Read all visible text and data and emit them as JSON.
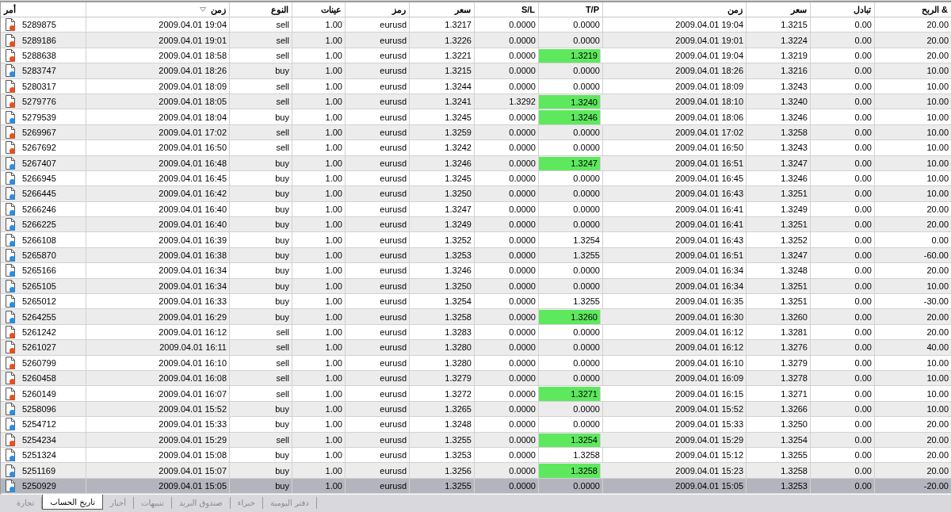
{
  "table": {
    "columns": [
      {
        "label": "أمر",
        "sorted": false
      },
      {
        "label": "زمن",
        "sorted": true
      },
      {
        "label": "النوع",
        "sorted": false
      },
      {
        "label": "عينات",
        "sorted": false
      },
      {
        "label": "رمز",
        "sorted": false
      },
      {
        "label": "سعر",
        "sorted": false
      },
      {
        "label": "S/L",
        "sorted": false
      },
      {
        "label": "T/P",
        "sorted": false
      },
      {
        "label": "زمن",
        "sorted": false
      },
      {
        "label": "سعر",
        "sorted": false
      },
      {
        "label": "تبادل",
        "sorted": false
      },
      {
        "label": "الربح &",
        "sorted": false
      }
    ],
    "rows": [
      {
        "color": "#e8501e",
        "tp_hit": false,
        "selected": false,
        "cells": [
          "5289875",
          "2009.04.01 19:04",
          "sell",
          "1.00",
          "eurusd",
          "1.3217",
          "0.0000",
          "0.0000",
          "2009.04.01 19:04",
          "1.3215",
          "0.00",
          "20.00"
        ]
      },
      {
        "color": "#e8501e",
        "tp_hit": false,
        "selected": false,
        "cells": [
          "5289186",
          "2009.04.01 19:01",
          "sell",
          "1.00",
          "eurusd",
          "1.3226",
          "0.0000",
          "0.0000",
          "2009.04.01 19:01",
          "1.3224",
          "0.00",
          "20.00"
        ]
      },
      {
        "color": "#e8501e",
        "tp_hit": true,
        "selected": false,
        "cells": [
          "5288638",
          "2009.04.01 18:58",
          "sell",
          "1.00",
          "eurusd",
          "1.3221",
          "0.0000",
          "1.3219",
          "2009.04.01 19:04",
          "1.3219",
          "0.00",
          "20.00"
        ]
      },
      {
        "color": "#2a8ee0",
        "tp_hit": false,
        "selected": false,
        "cells": [
          "5283747",
          "2009.04.01 18:26",
          "buy",
          "1.00",
          "eurusd",
          "1.3215",
          "0.0000",
          "0.0000",
          "2009.04.01 18:26",
          "1.3216",
          "0.00",
          "10.00"
        ]
      },
      {
        "color": "#e8501e",
        "tp_hit": false,
        "selected": false,
        "cells": [
          "5280317",
          "2009.04.01 18:09",
          "sell",
          "1.00",
          "eurusd",
          "1.3244",
          "0.0000",
          "0.0000",
          "2009.04.01 18:09",
          "1.3243",
          "0.00",
          "10.00"
        ]
      },
      {
        "color": "#e8501e",
        "tp_hit": true,
        "selected": false,
        "cells": [
          "5279776",
          "2009.04.01 18:05",
          "sell",
          "1.00",
          "eurusd",
          "1.3241",
          "1.3292",
          "1.3240",
          "2009.04.01 18:10",
          "1.3240",
          "0.00",
          "10.00"
        ]
      },
      {
        "color": "#2a8ee0",
        "tp_hit": true,
        "selected": false,
        "cells": [
          "5279539",
          "2009.04.01 18:04",
          "buy",
          "1.00",
          "eurusd",
          "1.3245",
          "0.0000",
          "1.3246",
          "2009.04.01 18:06",
          "1.3246",
          "0.00",
          "10.00"
        ]
      },
      {
        "color": "#e8501e",
        "tp_hit": false,
        "selected": false,
        "cells": [
          "5269967",
          "2009.04.01 17:02",
          "sell",
          "1.00",
          "eurusd",
          "1.3259",
          "0.0000",
          "0.0000",
          "2009.04.01 17:02",
          "1.3258",
          "0.00",
          "10.00"
        ]
      },
      {
        "color": "#e8501e",
        "tp_hit": false,
        "selected": false,
        "cells": [
          "5267692",
          "2009.04.01 16:50",
          "sell",
          "1.00",
          "eurusd",
          "1.3242",
          "0.0000",
          "0.0000",
          "2009.04.01 16:50",
          "1.3243",
          "0.00",
          "10.00"
        ]
      },
      {
        "color": "#2a8ee0",
        "tp_hit": true,
        "selected": false,
        "cells": [
          "5267407",
          "2009.04.01 16:48",
          "buy",
          "1.00",
          "eurusd",
          "1.3246",
          "0.0000",
          "1.3247",
          "2009.04.01 16:51",
          "1.3247",
          "0.00",
          "10.00"
        ]
      },
      {
        "color": "#2a8ee0",
        "tp_hit": false,
        "selected": false,
        "cells": [
          "5266945",
          "2009.04.01 16:45",
          "buy",
          "1.00",
          "eurusd",
          "1.3245",
          "0.0000",
          "0.0000",
          "2009.04.01 16:45",
          "1.3246",
          "0.00",
          "10.00"
        ]
      },
      {
        "color": "#2a8ee0",
        "tp_hit": false,
        "selected": false,
        "cells": [
          "5266445",
          "2009.04.01 16:42",
          "buy",
          "1.00",
          "eurusd",
          "1.3250",
          "0.0000",
          "0.0000",
          "2009.04.01 16:43",
          "1.3251",
          "0.00",
          "10.00"
        ]
      },
      {
        "color": "#2a8ee0",
        "tp_hit": false,
        "selected": false,
        "cells": [
          "5266246",
          "2009.04.01 16:40",
          "buy",
          "1.00",
          "eurusd",
          "1.3247",
          "0.0000",
          "0.0000",
          "2009.04.01 16:41",
          "1.3249",
          "0.00",
          "20.00"
        ]
      },
      {
        "color": "#2a8ee0",
        "tp_hit": false,
        "selected": false,
        "cells": [
          "5266225",
          "2009.04.01 16:40",
          "buy",
          "1.00",
          "eurusd",
          "1.3249",
          "0.0000",
          "0.0000",
          "2009.04.01 16:41",
          "1.3251",
          "0.00",
          "20.00"
        ]
      },
      {
        "color": "#2a8ee0",
        "tp_hit": false,
        "selected": false,
        "cells": [
          "5266108",
          "2009.04.01 16:39",
          "buy",
          "1.00",
          "eurusd",
          "1.3252",
          "0.0000",
          "1.3254",
          "2009.04.01 16:43",
          "1.3252",
          "0.00",
          "0.00"
        ]
      },
      {
        "color": "#2a8ee0",
        "tp_hit": false,
        "selected": false,
        "cells": [
          "5265870",
          "2009.04.01 16:38",
          "buy",
          "1.00",
          "eurusd",
          "1.3253",
          "0.0000",
          "1.3255",
          "2009.04.01 16:51",
          "1.3247",
          "0.00",
          "-60.00"
        ]
      },
      {
        "color": "#2a8ee0",
        "tp_hit": false,
        "selected": false,
        "cells": [
          "5265166",
          "2009.04.01 16:34",
          "buy",
          "1.00",
          "eurusd",
          "1.3246",
          "0.0000",
          "0.0000",
          "2009.04.01 16:34",
          "1.3248",
          "0.00",
          "20.00"
        ]
      },
      {
        "color": "#2a8ee0",
        "tp_hit": false,
        "selected": false,
        "cells": [
          "5265105",
          "2009.04.01 16:34",
          "buy",
          "1.00",
          "eurusd",
          "1.3250",
          "0.0000",
          "0.0000",
          "2009.04.01 16:34",
          "1.3251",
          "0.00",
          "10.00"
        ]
      },
      {
        "color": "#2a8ee0",
        "tp_hit": false,
        "selected": false,
        "cells": [
          "5265012",
          "2009.04.01 16:33",
          "buy",
          "1.00",
          "eurusd",
          "1.3254",
          "0.0000",
          "1.3255",
          "2009.04.01 16:35",
          "1.3251",
          "0.00",
          "-30.00"
        ]
      },
      {
        "color": "#2a8ee0",
        "tp_hit": true,
        "selected": false,
        "cells": [
          "5264255",
          "2009.04.01 16:29",
          "buy",
          "1.00",
          "eurusd",
          "1.3258",
          "0.0000",
          "1.3260",
          "2009.04.01 16:30",
          "1.3260",
          "0.00",
          "20.00"
        ]
      },
      {
        "color": "#e8501e",
        "tp_hit": false,
        "selected": false,
        "cells": [
          "5261242",
          "2009.04.01 16:12",
          "sell",
          "1.00",
          "eurusd",
          "1.3283",
          "0.0000",
          "0.0000",
          "2009.04.01 16:12",
          "1.3281",
          "0.00",
          "20.00"
        ]
      },
      {
        "color": "#e8501e",
        "tp_hit": false,
        "selected": false,
        "cells": [
          "5261027",
          "2009.04.01 16:11",
          "sell",
          "1.00",
          "eurusd",
          "1.3280",
          "0.0000",
          "0.0000",
          "2009.04.01 16:12",
          "1.3276",
          "0.00",
          "40.00"
        ]
      },
      {
        "color": "#e8501e",
        "tp_hit": false,
        "selected": false,
        "cells": [
          "5260799",
          "2009.04.01 16:10",
          "sell",
          "1.00",
          "eurusd",
          "1.3280",
          "0.0000",
          "0.0000",
          "2009.04.01 16:10",
          "1.3279",
          "0.00",
          "10.00"
        ]
      },
      {
        "color": "#e8501e",
        "tp_hit": false,
        "selected": false,
        "cells": [
          "5260458",
          "2009.04.01 16:08",
          "sell",
          "1.00",
          "eurusd",
          "1.3279",
          "0.0000",
          "0.0000",
          "2009.04.01 16:09",
          "1.3278",
          "0.00",
          "10.00"
        ]
      },
      {
        "color": "#e8501e",
        "tp_hit": true,
        "selected": false,
        "cells": [
          "5260149",
          "2009.04.01 16:07",
          "sell",
          "1.00",
          "eurusd",
          "1.3272",
          "0.0000",
          "1.3271",
          "2009.04.01 16:15",
          "1.3271",
          "0.00",
          "10.00"
        ]
      },
      {
        "color": "#2a8ee0",
        "tp_hit": false,
        "selected": false,
        "cells": [
          "5258096",
          "2009.04.01 15:52",
          "buy",
          "1.00",
          "eurusd",
          "1.3265",
          "0.0000",
          "0.0000",
          "2009.04.01 15:52",
          "1.3266",
          "0.00",
          "10.00"
        ]
      },
      {
        "color": "#2a8ee0",
        "tp_hit": false,
        "selected": false,
        "cells": [
          "5254712",
          "2009.04.01 15:33",
          "buy",
          "1.00",
          "eurusd",
          "1.3248",
          "0.0000",
          "0.0000",
          "2009.04.01 15:33",
          "1.3250",
          "0.00",
          "20.00"
        ]
      },
      {
        "color": "#e8501e",
        "tp_hit": true,
        "selected": false,
        "cells": [
          "5254234",
          "2009.04.01 15:29",
          "sell",
          "1.00",
          "eurusd",
          "1.3255",
          "0.0000",
          "1.3254",
          "2009.04.01 15:29",
          "1.3254",
          "0.00",
          "20.00"
        ]
      },
      {
        "color": "#2a8ee0",
        "tp_hit": false,
        "selected": false,
        "cells": [
          "5251324",
          "2009.04.01 15:08",
          "buy",
          "1.00",
          "eurusd",
          "1.3253",
          "0.0000",
          "1.3258",
          "2009.04.01 15:12",
          "1.3255",
          "0.00",
          "20.00"
        ]
      },
      {
        "color": "#2a8ee0",
        "tp_hit": true,
        "selected": false,
        "cells": [
          "5251169",
          "2009.04.01 15:07",
          "buy",
          "1.00",
          "eurusd",
          "1.3256",
          "0.0000",
          "1.3258",
          "2009.04.01 15:23",
          "1.3258",
          "0.00",
          "20.00"
        ]
      },
      {
        "color": "#2a8ee0",
        "tp_hit": false,
        "selected": true,
        "cells": [
          "5250929",
          "2009.04.01 15:05",
          "buy",
          "1.00",
          "eurusd",
          "1.3255",
          "0.0000",
          "0.0000",
          "2009.04.01 15:05",
          "1.3253",
          "0.00",
          "-20.00"
        ]
      }
    ]
  },
  "tabs": [
    {
      "label": "دفتر اليومية",
      "selected": false
    },
    {
      "label": "خبراء",
      "selected": false
    },
    {
      "label": "صندوق البريد",
      "selected": false
    },
    {
      "label": "تنبيهات",
      "selected": false
    },
    {
      "label": "أخبار",
      "selected": false
    },
    {
      "label": "تاريخ الحساب",
      "selected": true
    },
    {
      "label": "تجارة",
      "selected": false
    }
  ]
}
